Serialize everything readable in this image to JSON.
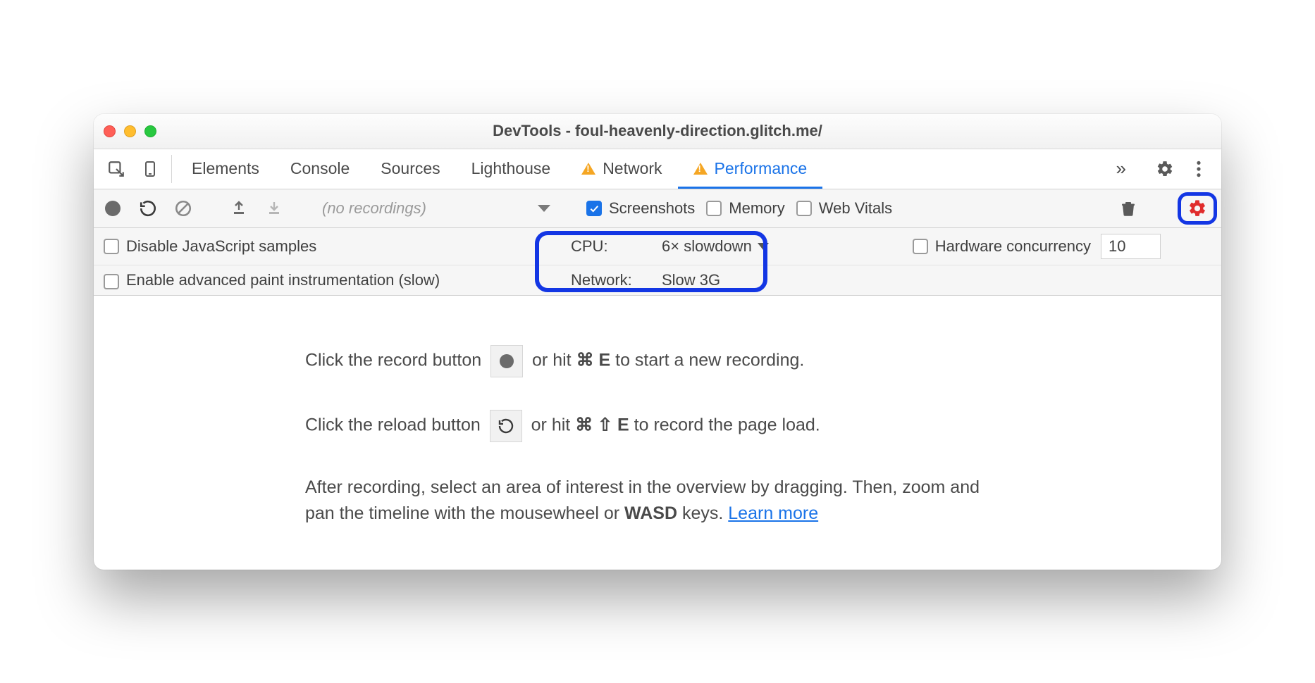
{
  "window": {
    "title": "DevTools - foul-heavenly-direction.glitch.me/"
  },
  "tabs": {
    "items": [
      {
        "label": "Elements",
        "warn": false,
        "active": false
      },
      {
        "label": "Console",
        "warn": false,
        "active": false
      },
      {
        "label": "Sources",
        "warn": false,
        "active": false
      },
      {
        "label": "Lighthouse",
        "warn": false,
        "active": false
      },
      {
        "label": "Network",
        "warn": true,
        "active": false
      },
      {
        "label": "Performance",
        "warn": true,
        "active": true
      }
    ],
    "overflow_glyph": "»"
  },
  "toolbar": {
    "recordings_placeholder": "(no recordings)",
    "screenshots": {
      "label": "Screenshots",
      "checked": true
    },
    "memory": {
      "label": "Memory",
      "checked": false
    },
    "webvitals": {
      "label": "Web Vitals",
      "checked": false
    }
  },
  "options": {
    "disable_js_samples": {
      "label": "Disable JavaScript samples",
      "checked": false
    },
    "advanced_paint": {
      "label": "Enable advanced paint instrumentation (slow)",
      "checked": false
    },
    "cpu": {
      "label": "CPU:",
      "value": "6× slowdown"
    },
    "network": {
      "label": "Network:",
      "value": "Slow 3G"
    },
    "hw": {
      "label": "Hardware concurrency",
      "value": "10"
    }
  },
  "content": {
    "line1_a": "Click the record button ",
    "line1_b": " or hit ",
    "line1_kbd": "⌘ E",
    "line1_c": " to start a new recording.",
    "line2_a": "Click the reload button ",
    "line2_b": " or hit ",
    "line2_kbd": "⌘ ⇧ E",
    "line2_c": " to record the page load.",
    "line3_a": "After recording, select an area of interest in the overview by dragging. Then, zoom and pan the timeline with the mousewheel or ",
    "line3_kbd": "WASD",
    "line3_b": " keys. ",
    "learn_more": "Learn more"
  }
}
